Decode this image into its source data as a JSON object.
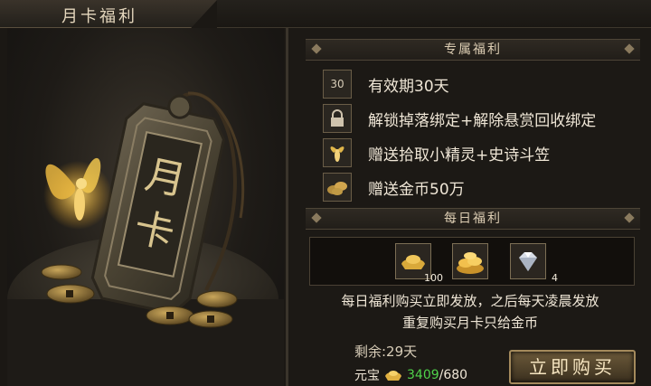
{
  "window": {
    "title": "月卡福利"
  },
  "card": {
    "text_top": "月",
    "text_bottom": "卡"
  },
  "exclusive": {
    "header": "专属福利",
    "items": [
      {
        "icon": "calendar-icon",
        "icon_text": "30",
        "label": "有效期30天"
      },
      {
        "icon": "lock-icon",
        "label": "解锁掉落绑定+解除悬赏回收绑定"
      },
      {
        "icon": "fairy-icon",
        "label": "赠送拾取小精灵+史诗斗笠"
      },
      {
        "icon": "gold-coins-icon",
        "label": "赠送金币50万"
      }
    ]
  },
  "daily": {
    "header": "每日福利",
    "items": [
      {
        "icon": "gold-ingot-icon",
        "count": "100"
      },
      {
        "icon": "gold-pile-icon",
        "count": ""
      },
      {
        "icon": "diamond-icon",
        "count": "4"
      }
    ],
    "desc_line1": "每日福利购买立即发放，之后每天凌晨发放",
    "desc_line2": "重复购买月卡只给金币"
  },
  "status": {
    "remaining": "剩余:29天",
    "currency_label": "元宝",
    "currency_current": "3409",
    "currency_sep": "/",
    "currency_total": "680"
  },
  "buy_button": "立即购买",
  "colors": {
    "accent_gold": "#a48a5c",
    "currency_green": "#4fd34a",
    "background": "#1b1814"
  }
}
